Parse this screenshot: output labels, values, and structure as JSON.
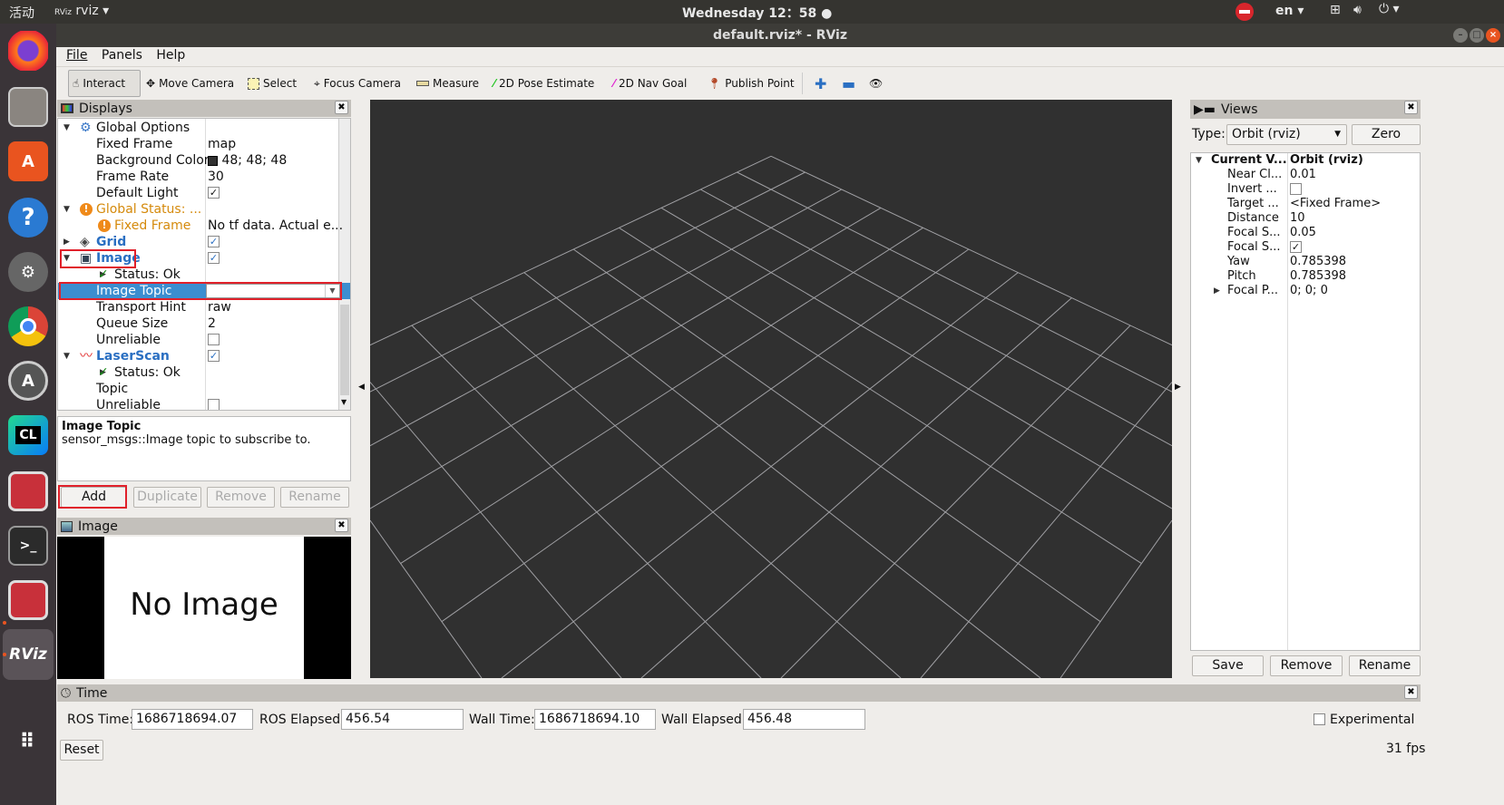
{
  "topbar": {
    "activities": "活动",
    "app_name": "rviz",
    "clock": "Wednesday 12：58",
    "lang": "en"
  },
  "dock": {
    "items": [
      {
        "icon": "firefox-icon"
      },
      {
        "icon": "files-icon"
      },
      {
        "icon": "software-center-icon"
      },
      {
        "icon": "help-icon"
      },
      {
        "icon": "settings-icon"
      },
      {
        "icon": "chrome-icon"
      },
      {
        "icon": "updater-icon"
      },
      {
        "icon": "clion-icon",
        "label": "CL"
      },
      {
        "icon": "terminator-icon"
      },
      {
        "icon": "terminal-icon",
        "label": ">_"
      },
      {
        "icon": "terminator-icon"
      },
      {
        "icon": "rviz-icon",
        "label": "RViz"
      },
      {
        "icon": "app-grid-icon"
      }
    ]
  },
  "window": {
    "title": "default.rviz* - RViz"
  },
  "menu": [
    "File",
    "Panels",
    "Help"
  ],
  "toolbar": {
    "tools": [
      "Interact",
      "Move Camera",
      "Select",
      "Focus Camera",
      "Measure",
      "2D Pose Estimate",
      "2D Nav Goal",
      "Publish Point"
    ],
    "active": "Interact"
  },
  "displays": {
    "title": "Displays",
    "rows": [
      {
        "name": "Global Options",
        "value": ""
      },
      {
        "name": "Fixed Frame",
        "value": "map"
      },
      {
        "name": "Background Color",
        "value": "48; 48; 48"
      },
      {
        "name": "Frame Rate",
        "value": "30"
      },
      {
        "name": "Default Light",
        "value": "checked"
      },
      {
        "name": "Global Status: ...",
        "value": ""
      },
      {
        "name": "Fixed Frame",
        "value": "No tf data.  Actual e..."
      },
      {
        "name": "Grid",
        "value": "checked"
      },
      {
        "name": "Image",
        "value": "checked"
      },
      {
        "name": "Status: Ok",
        "value": ""
      },
      {
        "name": "Image Topic",
        "value": ""
      },
      {
        "name": "Transport Hint",
        "value": "raw"
      },
      {
        "name": "Queue Size",
        "value": "2"
      },
      {
        "name": "Unreliable",
        "value": "unchecked"
      },
      {
        "name": "LaserScan",
        "value": "checked"
      },
      {
        "name": "Status: Ok",
        "value": ""
      },
      {
        "name": "Topic",
        "value": ""
      },
      {
        "name": "Unreliable",
        "value": "unchecked"
      }
    ],
    "description_title": "Image Topic",
    "description": "sensor_msgs::Image topic to subscribe to.",
    "buttons": [
      "Add",
      "Duplicate",
      "Remove",
      "Rename"
    ]
  },
  "image_panel": {
    "title": "Image",
    "placeholder": "No Image"
  },
  "viewport": {
    "background": "#303030",
    "grid_color": "#a0a0a4"
  },
  "views": {
    "title": "Views",
    "type_label": "Type:",
    "type_value": "Orbit (rviz)",
    "zero": "Zero",
    "rows": [
      {
        "name": "Current V...",
        "value": "Orbit (rviz)"
      },
      {
        "name": "Near Cl...",
        "value": "0.01"
      },
      {
        "name": "Invert ...",
        "value": "unchecked"
      },
      {
        "name": "Target ...",
        "value": "<Fixed Frame>"
      },
      {
        "name": "Distance",
        "value": "10"
      },
      {
        "name": "Focal S...",
        "value": "0.05"
      },
      {
        "name": "Focal S...",
        "value": "checked"
      },
      {
        "name": "Yaw",
        "value": "0.785398"
      },
      {
        "name": "Pitch",
        "value": "0.785398"
      },
      {
        "name": "Focal P...",
        "value": "0; 0; 0"
      }
    ],
    "buttons": [
      "Save",
      "Remove",
      "Rename"
    ]
  },
  "time": {
    "title": "Time",
    "ros_time_label": "ROS Time:",
    "ros_time": "1686718694.07",
    "ros_elapsed_label": "ROS Elapsed:",
    "ros_elapsed": "456.54",
    "wall_time_label": "Wall Time:",
    "wall_time": "1686718694.10",
    "wall_elapsed_label": "Wall Elapsed:",
    "wall_elapsed": "456.48",
    "experimental": "Experimental",
    "reset": "Reset",
    "fps": "31 fps"
  }
}
